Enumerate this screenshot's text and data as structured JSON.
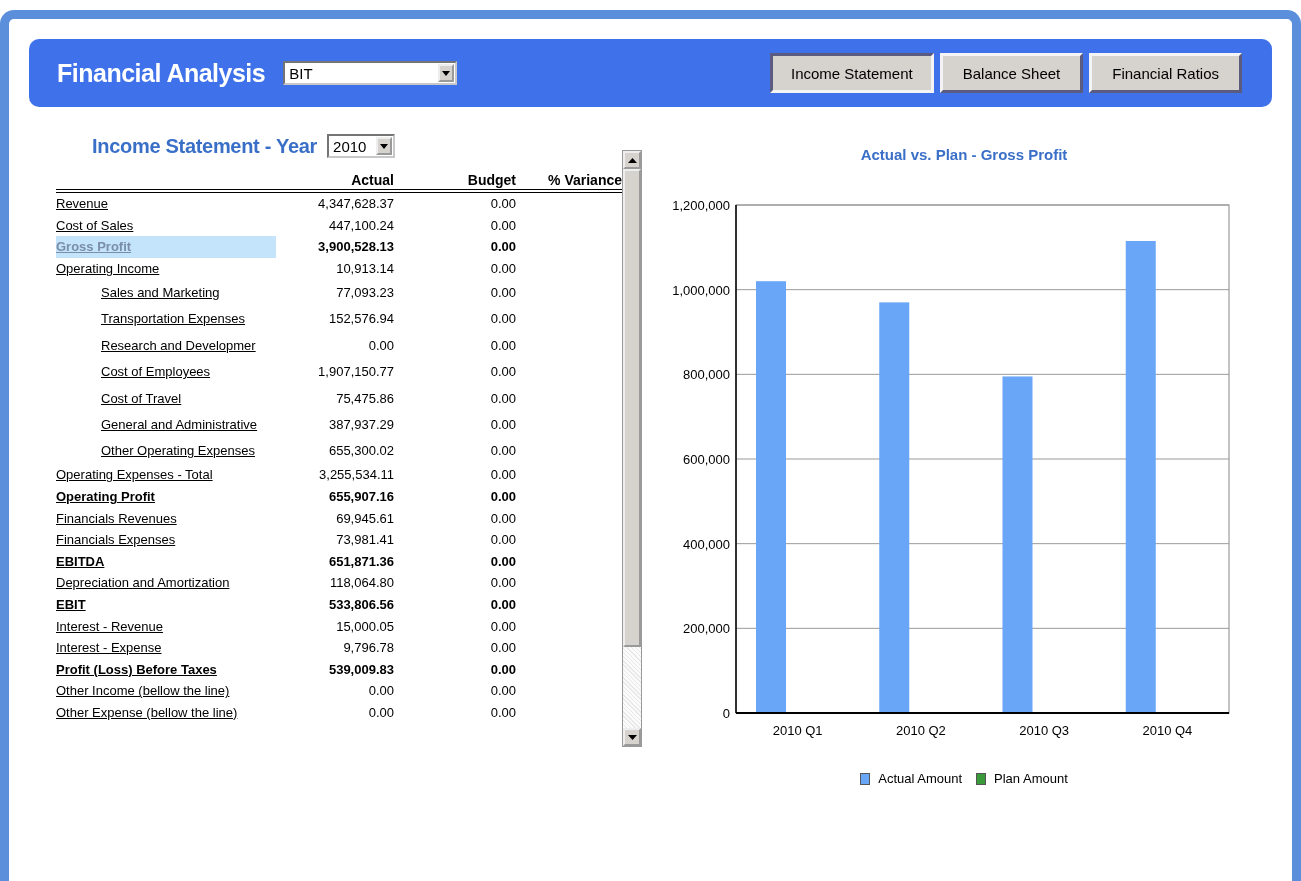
{
  "header": {
    "title": "Financial Analysis",
    "company_select": {
      "value": "BIT"
    },
    "buttons": [
      {
        "label": "Income Statement",
        "selected": true
      },
      {
        "label": "Balance Sheet",
        "selected": false
      },
      {
        "label": "Financial Ratios",
        "selected": false
      }
    ]
  },
  "statement": {
    "title": "Income Statement - Year",
    "year_select": {
      "value": "2010"
    },
    "columns": [
      "Actual",
      "Budget",
      "% Variance"
    ],
    "rows": [
      {
        "label": "Revenue",
        "kind": "line",
        "selected": false,
        "actual": "4,347,628.37",
        "budget": "0.00"
      },
      {
        "label": "Cost of Sales",
        "kind": "line",
        "selected": false,
        "actual": "447,100.24",
        "budget": "0.00"
      },
      {
        "label": "Gross Profit",
        "kind": "total",
        "selected": true,
        "actual": "3,900,528.13",
        "budget": "0.00"
      },
      {
        "label": "Operating Income",
        "kind": "line",
        "selected": false,
        "actual": "10,913.14",
        "budget": "0.00",
        "children": [
          {
            "label": "Sales and Marketing",
            "kind": "line",
            "selected": false,
            "actual": "77,093.23",
            "budget": "0.00"
          },
          {
            "label": "Transportation Expenses",
            "kind": "line",
            "selected": false,
            "actual": "152,576.94",
            "budget": "0.00"
          },
          {
            "label": "Research and Developmer",
            "kind": "line",
            "selected": false,
            "actual": "0.00",
            "budget": "0.00"
          },
          {
            "label": "Cost of Employees",
            "kind": "line",
            "selected": false,
            "actual": "1,907,150.77",
            "budget": "0.00"
          },
          {
            "label": "Cost of Travel",
            "kind": "line",
            "selected": false,
            "actual": "75,475.86",
            "budget": "0.00"
          },
          {
            "label": "General and Administrative",
            "kind": "line",
            "selected": false,
            "actual": "387,937.29",
            "budget": "0.00"
          },
          {
            "label": "Other Operating Expenses",
            "kind": "line",
            "selected": false,
            "actual": "655,300.02",
            "budget": "0.00"
          }
        ]
      },
      {
        "label": "Operating Expenses - Total",
        "kind": "line",
        "selected": false,
        "actual": "3,255,534.11",
        "budget": "0.00"
      },
      {
        "label": "Operating Profit",
        "kind": "total",
        "selected": false,
        "actual": "655,907.16",
        "budget": "0.00"
      },
      {
        "label": "Financials Revenues",
        "kind": "line",
        "selected": false,
        "actual": "69,945.61",
        "budget": "0.00"
      },
      {
        "label": "Financials Expenses",
        "kind": "line",
        "selected": false,
        "actual": "73,981.41",
        "budget": "0.00"
      },
      {
        "label": "EBITDA",
        "kind": "total",
        "selected": false,
        "actual": "651,871.36",
        "budget": "0.00"
      },
      {
        "label": "Depreciation and Amortization",
        "kind": "line",
        "selected": false,
        "actual": "118,064.80",
        "budget": "0.00"
      },
      {
        "label": "EBIT",
        "kind": "total",
        "selected": false,
        "actual": "533,806.56",
        "budget": "0.00"
      },
      {
        "label": "Interest - Revenue",
        "kind": "line",
        "selected": false,
        "actual": "15,000.05",
        "budget": "0.00"
      },
      {
        "label": "Interest - Expense",
        "kind": "line",
        "selected": false,
        "actual": "9,796.78",
        "budget": "0.00"
      },
      {
        "label": "Profit (Loss) Before Taxes",
        "kind": "total",
        "selected": false,
        "actual": "539,009.83",
        "budget": "0.00"
      },
      {
        "label": "Other Income (bellow the line)",
        "kind": "line",
        "selected": false,
        "actual": "0.00",
        "budget": "0.00"
      },
      {
        "label": "Other Expense (bellow the line)",
        "kind": "line",
        "selected": false,
        "actual": "0.00",
        "budget": "0.00"
      }
    ]
  },
  "chart": {
    "chart_data": {
      "type": "bar",
      "title": "Actual vs. Plan - Gross Profit",
      "categories": [
        "2010 Q1",
        "2010 Q2",
        "2010 Q3",
        "2010 Q4"
      ],
      "series": [
        {
          "name": "Actual Amount",
          "color": "#6aa6f8",
          "values": [
            1020000,
            970000,
            795000,
            1115000
          ]
        },
        {
          "name": "Plan Amount",
          "color": "#3a9a3a",
          "values": [
            0,
            0,
            0,
            0
          ]
        }
      ],
      "ylim": [
        0,
        1200000
      ],
      "grid": true,
      "yticks": [
        {
          "value": 0,
          "label": "0"
        },
        {
          "value": 200000,
          "label": "200,000"
        },
        {
          "value": 400000,
          "label": "400,000"
        },
        {
          "value": 600000,
          "label": "600,000"
        },
        {
          "value": 800000,
          "label": "800,000"
        },
        {
          "value": 1000000,
          "label": "1,000,000"
        },
        {
          "value": 1200000,
          "label": "1,200,000"
        }
      ]
    }
  }
}
